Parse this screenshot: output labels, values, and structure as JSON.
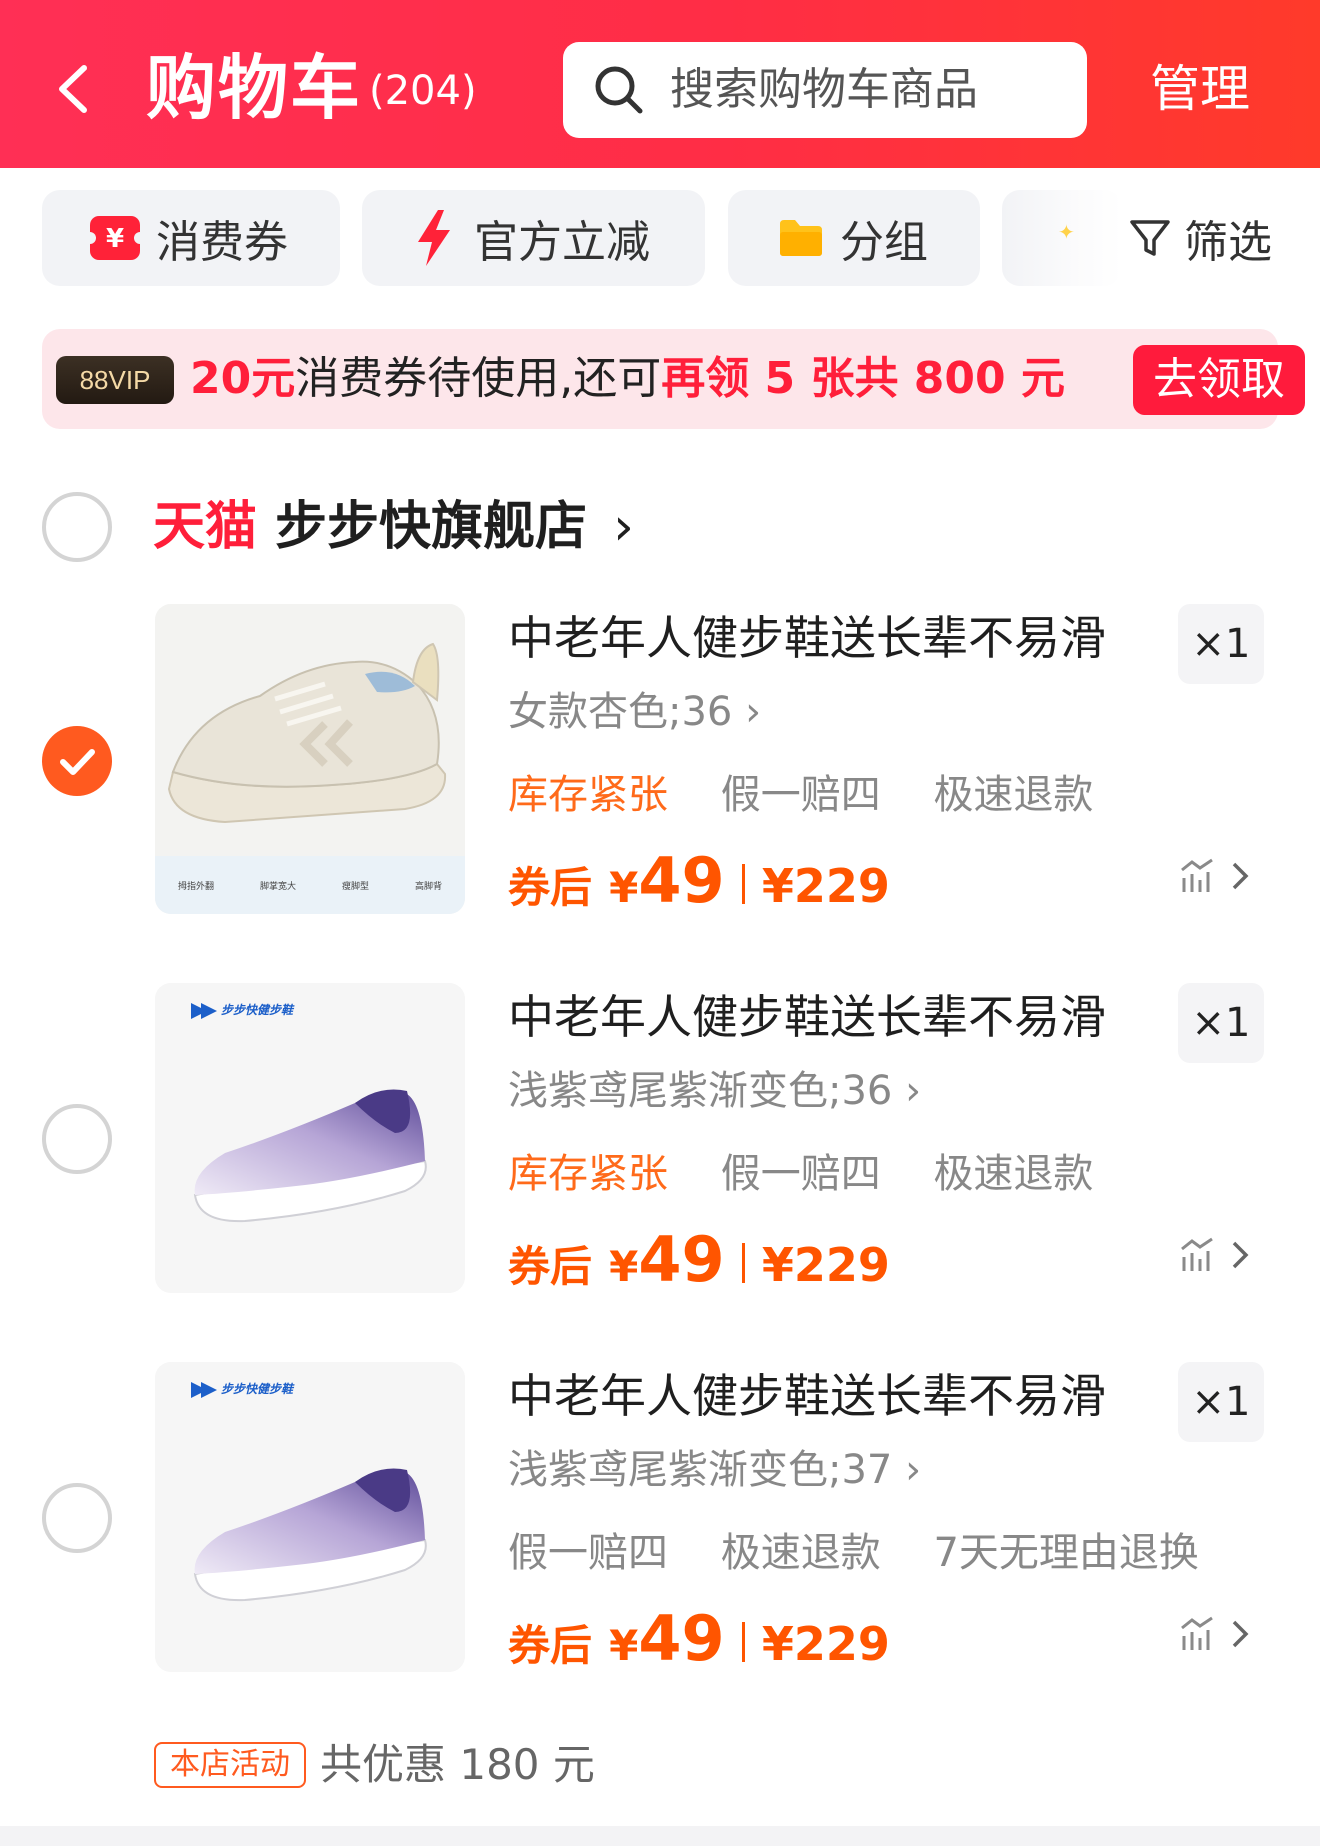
{
  "header": {
    "title": "购物车",
    "count": "(204)",
    "search_placeholder": "搜索购物车商品",
    "manage_label": "管理"
  },
  "filters": [
    {
      "label": "消费券",
      "icon": "coupon-icon"
    },
    {
      "label": "官方立减",
      "icon": "lightning-icon"
    },
    {
      "label": "分组",
      "icon": "folder-icon"
    }
  ],
  "filter_button": {
    "label": "筛选",
    "icon": "funnel-icon"
  },
  "vip_banner": {
    "badge": "88VIP",
    "amount": "20元",
    "text1": "消费券待使用,还可",
    "highlight": "再领 5 张共 800 元",
    "button": "去领取"
  },
  "store": {
    "brand": "天猫",
    "name": "步步快旗舰店",
    "chevron": "›"
  },
  "items": [
    {
      "title": "中老年人健步鞋送长辈不易滑",
      "spec": "女款杏色;36",
      "qty": "×1",
      "tags": [
        "库存紧张",
        "假一赔四",
        "极速退款"
      ],
      "hot_tag_index": 0,
      "price_prefix": "券后",
      "price_yen": "¥",
      "price": "49",
      "orig_yen": "¥",
      "orig_price": "229",
      "checked": true,
      "image": "beige-sneaker",
      "thumb_caption": [
        "拇指外翻",
        "脚掌宽大",
        "瘦脚型",
        "高脚背"
      ]
    },
    {
      "title": "中老年人健步鞋送长辈不易滑",
      "spec": "浅紫鸢尾紫渐变色;36",
      "qty": "×1",
      "tags": [
        "库存紧张",
        "假一赔四",
        "极速退款"
      ],
      "hot_tag_index": 0,
      "price_prefix": "券后",
      "price_yen": "¥",
      "price": "49",
      "orig_yen": "¥",
      "orig_price": "229",
      "checked": false,
      "image": "purple-slip-on",
      "brand_text": "步步快健步鞋"
    },
    {
      "title": "中老年人健步鞋送长辈不易滑",
      "spec": "浅紫鸢尾紫渐变色;37",
      "qty": "×1",
      "tags": [
        "假一赔四",
        "极速退款",
        "7天无理由退换"
      ],
      "hot_tag_index": -1,
      "price_prefix": "券后",
      "price_yen": "¥",
      "price": "49",
      "orig_yen": "¥",
      "orig_price": "229",
      "checked": false,
      "image": "purple-slip-on",
      "brand_text": "步步快健步鞋"
    }
  ],
  "footer": {
    "activity_badge": "本店活动",
    "activity_text": "共优惠 180 元"
  },
  "colors": {
    "header_red": "#ff2d45",
    "price_orange": "#ff5500",
    "check_orange": "#ff5a1f",
    "tmall_red": "#ff1f3a"
  }
}
